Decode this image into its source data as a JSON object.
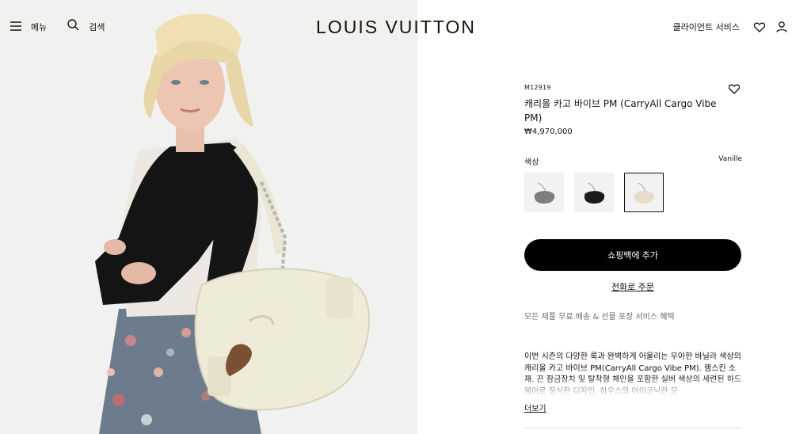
{
  "header": {
    "menu_label": "메뉴",
    "search_label": "검색",
    "logo": "LOUIS VUITTON",
    "client_service_label": "클라이언트 서비스",
    "icons": [
      "menu-icon",
      "search-icon",
      "heart-icon",
      "user-icon"
    ]
  },
  "hero": {
    "image": "model-with-cream-shoulder-bag"
  },
  "product": {
    "sku": "M12919",
    "title": "캐리올 카고 바이브 PM (CarryAll Cargo Vibe PM)",
    "price": "₩4,970,000",
    "color_label": "색상",
    "color_value": "Vanille",
    "swatches": [
      {
        "name": "grey-bag",
        "color": "#7e7e7e",
        "selected": false
      },
      {
        "name": "black-bag",
        "color": "#1b1b1b",
        "selected": false
      },
      {
        "name": "vanille-bag",
        "color": "#e7dccb",
        "selected": true
      }
    ],
    "add_to_bag_label": "쇼핑백에 추가",
    "phone_order_label": "전화로 주문",
    "benefit_text": "모든 제품 무료 배송 & 선물 포장 서비스 혜택",
    "description": "이번 시즌의 다양한 룩과 완벽하게 어울리는 우아한 바닐라 색상의 캐리올 카고 바이브 PM(CarryAll Cargo Vibe PM). 램스킨 소재. 끈 잠금장치 및 탈착형 체인을 포함한 실버 색상의 세련된 하드웨어로 장식한 디자인. 하우스의 아이코닉한 모",
    "more_label": "더보기"
  },
  "colors": {
    "text": "#19110b",
    "cta_bg": "#000000",
    "muted": "#6b6b6b"
  }
}
